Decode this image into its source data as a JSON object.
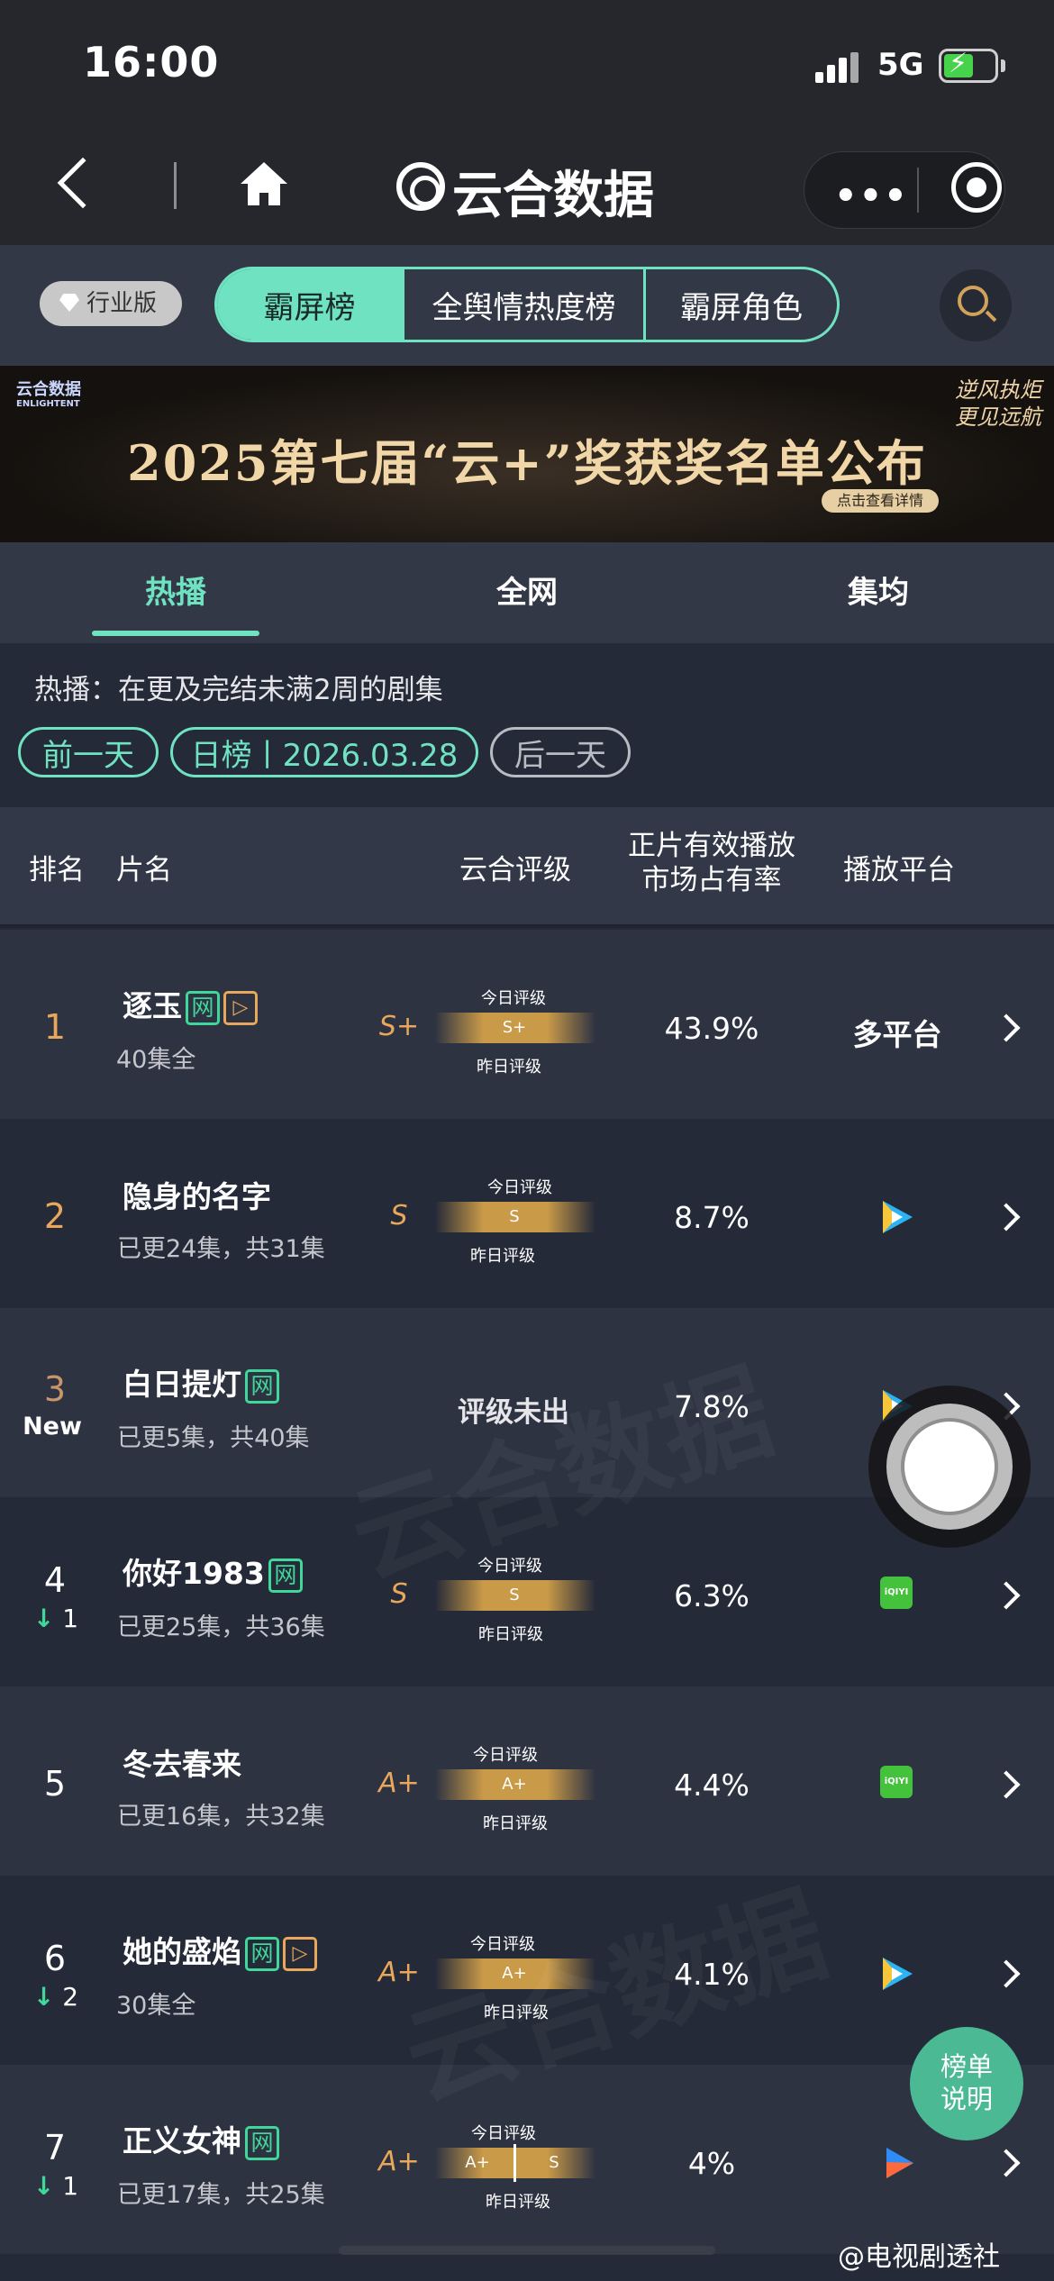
{
  "status_bar": {
    "time": "16:00",
    "network": "5G"
  },
  "nav": {
    "title": "云合数据"
  },
  "top_tabs": {
    "badge": "行业版",
    "items": [
      "霸屏榜",
      "全舆情热度榜",
      "霸屏角色"
    ]
  },
  "banner": {
    "logo": "云合数据",
    "logo_en": "ENLIGHTENT",
    "title": "2025第七届“云+”奖获奖名单公布",
    "button": "点击查看详情",
    "slogan": "逆风执炬 更见远航"
  },
  "sub_tabs": [
    "热播",
    "全网",
    "集均"
  ],
  "description": "热播：在更及完结未满2周的剧集",
  "date_nav": {
    "prev": "前一天",
    "current": "日榜丨2026.03.28",
    "next": "后一天"
  },
  "table_header": {
    "rank": "排名",
    "name": "片名",
    "grade": "云合评级",
    "share_line1": "正片有效播放",
    "share_line2": "市场占有率",
    "platform": "播放平台"
  },
  "grade_labels": {
    "today": "今日评级",
    "yesterday": "昨日评级"
  },
  "rows": [
    {
      "rank": "1",
      "title": "逐玉",
      "eps": "40集全",
      "grade": "S+",
      "bar": "S+",
      "share": "43.9%",
      "platform": "多平台"
    },
    {
      "rank": "2",
      "title": "隐身的名字",
      "eps": "已更24集，共31集",
      "grade": "S",
      "bar": "S",
      "share": "8.7%"
    },
    {
      "rank": "3",
      "new": "New",
      "title": "白日提灯",
      "eps": "已更5集，共40集",
      "nograde": "评级未出",
      "share": "7.8%"
    },
    {
      "rank": "4",
      "change": "1",
      "title": "你好1983",
      "eps": "已更25集，共36集",
      "grade": "S",
      "bar": "S",
      "share": "6.3%"
    },
    {
      "rank": "5",
      "title": "冬去春来",
      "eps": "已更16集，共32集",
      "grade": "A+",
      "bar": "A+",
      "share": "4.4%"
    },
    {
      "rank": "6",
      "change": "2",
      "title": "她的盛焰",
      "eps": "30集全",
      "grade": "A+",
      "bar": "A+",
      "share": "4.1%"
    },
    {
      "rank": "7",
      "change": "1",
      "title": "正义女神",
      "eps": "已更17集，共25集",
      "grade": "A+",
      "bar_left": "A+",
      "bar_right": "S",
      "share": "4%"
    }
  ],
  "tags": {
    "net": "网",
    "play": "▷"
  },
  "platform_icons": {
    "iqiyi": "iQIYI"
  },
  "watermark": {
    "cn": "云合数据",
    "en": "ENLIGHTENT"
  },
  "explain_button": {
    "line1": "榜单",
    "line2": "说明"
  },
  "source": "@电视剧透社",
  "colors": {
    "accent": "#6fe3c1",
    "gold": "#e8a75a",
    "down": "#3fd89a"
  }
}
